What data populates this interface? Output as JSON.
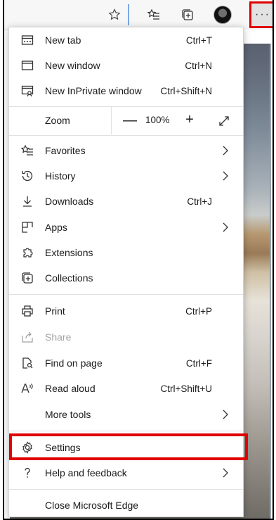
{
  "colors": {
    "highlight": "#e00000",
    "menu_bg": "#ffffff",
    "separator": "#e1e1e1",
    "disabled_text": "#a3a3a3"
  },
  "toolbar": {
    "icons": [
      "favorite-star-icon",
      "favorites-list-icon",
      "collections-icon",
      "profile-avatar"
    ],
    "more_label": "···"
  },
  "menu": {
    "new_tab": {
      "label": "New tab",
      "shortcut": "Ctrl+T",
      "icon": "new-tab-icon"
    },
    "new_window": {
      "label": "New window",
      "shortcut": "Ctrl+N",
      "icon": "window-icon"
    },
    "new_inprivate": {
      "label": "New InPrivate window",
      "shortcut": "Ctrl+Shift+N",
      "icon": "inprivate-icon"
    },
    "zoom": {
      "label": "Zoom",
      "minus": "—",
      "value": "100%",
      "plus": "+",
      "fullscreen_icon": "fullscreen-icon"
    },
    "favorites": {
      "label": "Favorites",
      "icon": "favorites-icon"
    },
    "history": {
      "label": "History",
      "icon": "history-icon"
    },
    "downloads": {
      "label": "Downloads",
      "shortcut": "Ctrl+J",
      "icon": "download-icon"
    },
    "apps": {
      "label": "Apps",
      "icon": "apps-icon"
    },
    "extensions": {
      "label": "Extensions",
      "icon": "extensions-icon"
    },
    "collections": {
      "label": "Collections",
      "icon": "collections-icon"
    },
    "print": {
      "label": "Print",
      "shortcut": "Ctrl+P",
      "icon": "print-icon"
    },
    "share": {
      "label": "Share",
      "icon": "share-icon",
      "disabled": true
    },
    "find": {
      "label": "Find on page",
      "shortcut": "Ctrl+F",
      "icon": "find-icon"
    },
    "read_aloud": {
      "label": "Read aloud",
      "shortcut": "Ctrl+Shift+U",
      "icon": "read-aloud-icon"
    },
    "more_tools": {
      "label": "More tools"
    },
    "settings": {
      "label": "Settings",
      "icon": "gear-icon"
    },
    "help": {
      "label": "Help and feedback",
      "icon": "help-icon"
    },
    "close": {
      "label": "Close Microsoft Edge"
    }
  }
}
